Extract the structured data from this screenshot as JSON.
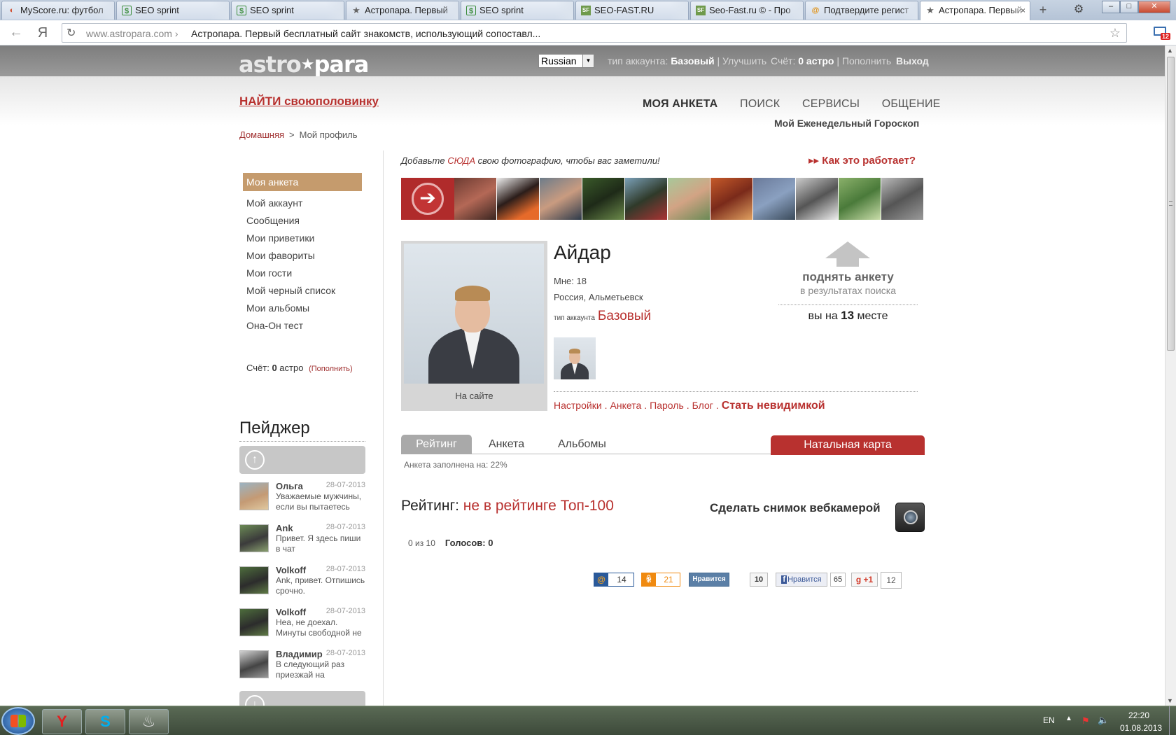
{
  "browser": {
    "tabs": [
      {
        "label": "MyScore.ru: футбол",
        "icon": "myscore-icon"
      },
      {
        "label": "SEO sprint",
        "icon": "seosprint-icon"
      },
      {
        "label": "SEO sprint",
        "icon": "seosprint-icon"
      },
      {
        "label": "Астропара. Первый",
        "icon": "star-icon"
      },
      {
        "label": "SEO sprint",
        "icon": "seosprint-icon"
      },
      {
        "label": "SEO-FAST.RU",
        "icon": "seofast-icon"
      },
      {
        "label": "Seo-Fast.ru © - Про",
        "icon": "seofast-icon"
      },
      {
        "label": "Подтвердите регист",
        "icon": "mail-at-icon"
      },
      {
        "label": "Астропара. Первый",
        "icon": "star-icon"
      }
    ],
    "tab_close": "×",
    "address": {
      "host": "www.astropara.com",
      "separator": " › ",
      "title": "Астропара. Первый бесплатный сайт знакомств, использующий сопоставл..."
    },
    "yandex_button": "Я",
    "mail_badge": "12"
  },
  "header": {
    "logo_part1": "astro",
    "logo_star": "★",
    "logo_part2": "para",
    "language": "Russian",
    "account_type_label": "тип аккаунта:",
    "account_type_value": "Базовый",
    "upgrade_link": "Улучшить",
    "balance_label": "Счёт:",
    "balance_value": "0 астро",
    "topup_link": "Пополнить",
    "pipe": "|",
    "logout": "Выход"
  },
  "top": {
    "find_link": "НАЙТИ своюполовинку",
    "nav": [
      "МОЯ АНКЕТА",
      "ПОИСК",
      "СЕРВИСЫ",
      "ОБЩЕНИЕ"
    ],
    "horoscope": "Мой Еженедельный Гороскоп",
    "breadcrumb": {
      "home": "Домашняя",
      "sep": ">",
      "current": "Мой профиль"
    }
  },
  "sidebar": {
    "active": "Моя анкета",
    "items": [
      "Мой аккаунт",
      "Сообщения",
      "Мои приветики",
      "Мои фавориты",
      "Мои гости",
      "Мой черный список",
      "Мои альбомы",
      "Она-Он тест"
    ],
    "balance_label": "Счёт:",
    "balance_value": "0",
    "balance_unit": "астро",
    "balance_link": "(Пополнить)"
  },
  "pager": {
    "title": "Пейджер",
    "up": "↑",
    "down": "↓",
    "messages": [
      {
        "name": "Ольга",
        "date": "28-07-2013",
        "text": "Уважаемые мужчины, если вы пытаетесь"
      },
      {
        "name": "Ank",
        "date": "28-07-2013",
        "text": "Привет. Я здесь пиши в чат"
      },
      {
        "name": "Volkoff",
        "date": "28-07-2013",
        "text": "Ank, привет. Отпишись срочно."
      },
      {
        "name": "Volkoff",
        "date": "28-07-2013",
        "text": "Неа, не доехал. Минуты свободной не"
      },
      {
        "name": "Владимир",
        "date": "28-07-2013",
        "text": "В следующий раз приезжай на"
      }
    ]
  },
  "promo": {
    "add_photo_before": "Добавьте ",
    "add_photo_here": "СЮДА",
    "add_photo_after": " свою фотографию, чтобы вас заметили!",
    "how_it_works": "Как это работает?",
    "arrow": "➔"
  },
  "profile": {
    "name": "Айдар",
    "age": "Мне: 18",
    "location": "Россия, Альметьевск",
    "account_type_label": "тип аккаунта",
    "account_type_value": "Базовый",
    "online_status": "На сайте",
    "raise_title": "поднять анкету",
    "raise_sub": "в результатах поиска",
    "place_before": "вы на ",
    "place_value": "13",
    "place_after": " месте",
    "links": [
      "Настройки",
      "Анкета",
      "Пароль",
      "Блог"
    ],
    "link_dot": ".",
    "invisible_link": "Стать невидимкой"
  },
  "tabs": {
    "items": [
      "Рейтинг",
      "Анкета",
      "Альбомы"
    ],
    "natal_chart": "Натальная карта",
    "completion": "Анкета заполнена на:   22%"
  },
  "rating": {
    "label": "Рейтинг: ",
    "value": "не в рейтинге Топ-100",
    "webcam": "Сделать снимок вебкамерой",
    "score": "0 из 10",
    "votes": "Голосов: 0"
  },
  "social": {
    "mail_icon": "@",
    "mail_count": "14",
    "ok_icon": "ok",
    "ok_count": "21",
    "vk_label": "Нравится",
    "vk_count": "10",
    "fb_icon": "f",
    "fb_label": "Нравится",
    "fb_count": "65",
    "gplus_label": "+1",
    "gplus_count": "12"
  },
  "taskbar": {
    "yandex": "Y",
    "skype": "S",
    "steam": "♨",
    "language": "EN",
    "tray_up": "▲",
    "time": "22:20",
    "date": "01.08.2013"
  }
}
